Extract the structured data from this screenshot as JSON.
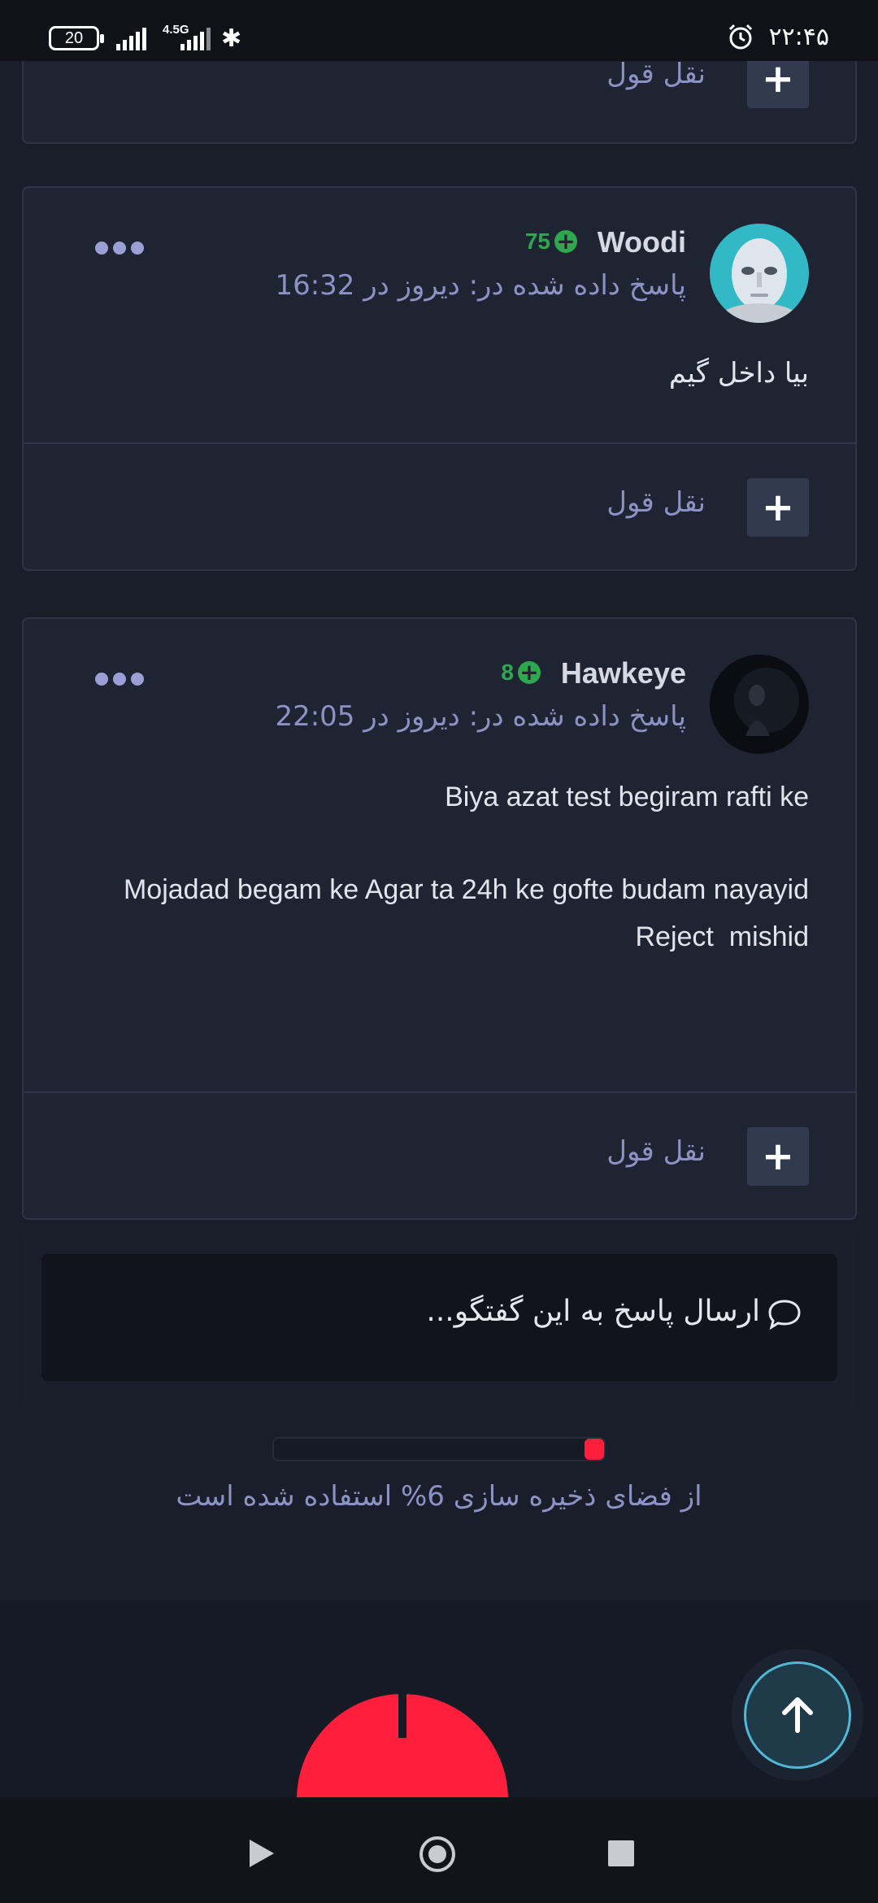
{
  "status_bar": {
    "battery": "20",
    "network": "4.5G",
    "time": "۲۲:۴۵"
  },
  "posts": [
    {
      "quote_label": "نقل قول",
      "quote_symbol": "+"
    },
    {
      "username": "Woodi",
      "reputation": "75",
      "posted": "پاسخ داده شده در: دیروز در 16:32",
      "body": [
        "بیا داخل گیم"
      ],
      "quote_label": "نقل قول",
      "quote_symbol": "+"
    },
    {
      "username": "Hawkeye",
      "reputation": "8",
      "posted": "پاسخ داده شده در: دیروز در 22:05",
      "body": [
        "Biya azat test begiram rafti ke",
        "Mojadad begam ke Agar ta 24h ke gofte budam nayayid",
        "Reject  mishid"
      ],
      "quote_label": "نقل قول",
      "quote_symbol": "+"
    }
  ],
  "reply": {
    "placeholder": "ارسال پاسخ به این گفتگو..."
  },
  "storage": {
    "used_fraction": 0.06,
    "label": "از فضای ذخیره سازی 6% استفاده شده است"
  },
  "colors": {
    "accent": "#ff1f3d",
    "reputation": "#2ea84f",
    "meta_text": "#8c92c4"
  }
}
